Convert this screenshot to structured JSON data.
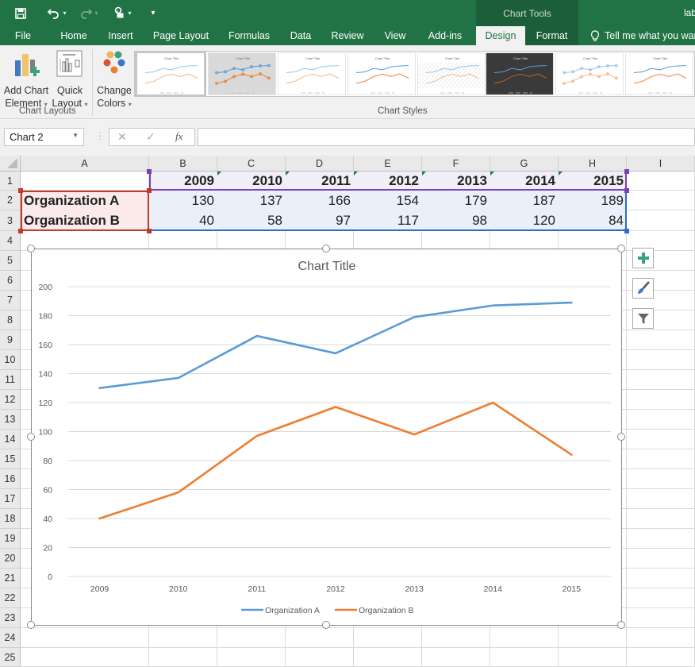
{
  "titlebar": {
    "context_label": "Chart Tools",
    "window_title": "lab",
    "qat": {
      "save_icon": "save-icon",
      "undo_icon": "undo-icon",
      "redo_icon": "redo-icon",
      "touch_icon": "touch-mode-icon",
      "customize_icon": "customize-qat-icon"
    }
  },
  "tabs": [
    {
      "label": "File"
    },
    {
      "label": "Home"
    },
    {
      "label": "Insert"
    },
    {
      "label": "Page Layout"
    },
    {
      "label": "Formulas"
    },
    {
      "label": "Data"
    },
    {
      "label": "Review"
    },
    {
      "label": "View"
    },
    {
      "label": "Add-ins"
    },
    {
      "label": "Design",
      "active": true
    },
    {
      "label": "Format"
    }
  ],
  "tellme": {
    "icon": "lightbulb-icon",
    "label": "Tell me what you want to do"
  },
  "ribbon": {
    "add_chart_element": {
      "line1": "Add Chart",
      "line2": "Element"
    },
    "quick_layout": {
      "line1": "Quick",
      "line2": "Layout"
    },
    "change_colors": {
      "line1": "Change",
      "line2": "Colors"
    },
    "group_chart_layouts": "Chart Layouts",
    "group_chart_styles": "Chart Styles",
    "style_thumb_title": "Chart Title"
  },
  "formula_bar": {
    "name_box": "Chart 2",
    "cancel_icon": "✕",
    "enter_icon": "✓",
    "fx_label": "fx",
    "formula": ""
  },
  "sheet": {
    "columns": [
      "A",
      "B",
      "C",
      "D",
      "E",
      "F",
      "G",
      "H",
      "I"
    ],
    "rows": [
      "1",
      "2",
      "3",
      "4",
      "5",
      "6",
      "7",
      "8",
      "9",
      "10",
      "11",
      "12",
      "13",
      "14",
      "15",
      "16",
      "17",
      "18",
      "19",
      "20",
      "21",
      "22",
      "23",
      "24",
      "25"
    ],
    "header_row": [
      "",
      "2009",
      "2010",
      "2011",
      "2012",
      "2013",
      "2014",
      "2015"
    ],
    "data_rows": [
      {
        "label": "Organization A",
        "values": [
          "130",
          "137",
          "166",
          "154",
          "179",
          "187",
          "189"
        ]
      },
      {
        "label": "Organization B",
        "values": [
          "40",
          "58",
          "97",
          "117",
          "98",
          "120",
          "84"
        ]
      }
    ]
  },
  "chart_side_buttons": {
    "elements": "chart-elements-plus-icon",
    "styles": "chart-styles-brush-icon",
    "filters": "chart-filters-funnel-icon"
  },
  "colors": {
    "excel_green": "#217346",
    "series_a": "#5b9bd5",
    "series_b": "#ed7d31"
  },
  "chart_data": {
    "type": "line",
    "title": "Chart Title",
    "categories": [
      "2009",
      "2010",
      "2011",
      "2012",
      "2013",
      "2014",
      "2015"
    ],
    "series": [
      {
        "name": "Organization A",
        "values": [
          130,
          137,
          166,
          154,
          179,
          187,
          189
        ],
        "color": "#5b9bd5"
      },
      {
        "name": "Organization B",
        "values": [
          40,
          58,
          97,
          117,
          98,
          120,
          84
        ],
        "color": "#ed7d31"
      }
    ],
    "xlabel": "",
    "ylabel": "",
    "ylim": [
      0,
      200
    ],
    "yticks": [
      0,
      20,
      40,
      60,
      80,
      100,
      120,
      140,
      160,
      180,
      200
    ],
    "grid": true,
    "legend": "bottom"
  }
}
